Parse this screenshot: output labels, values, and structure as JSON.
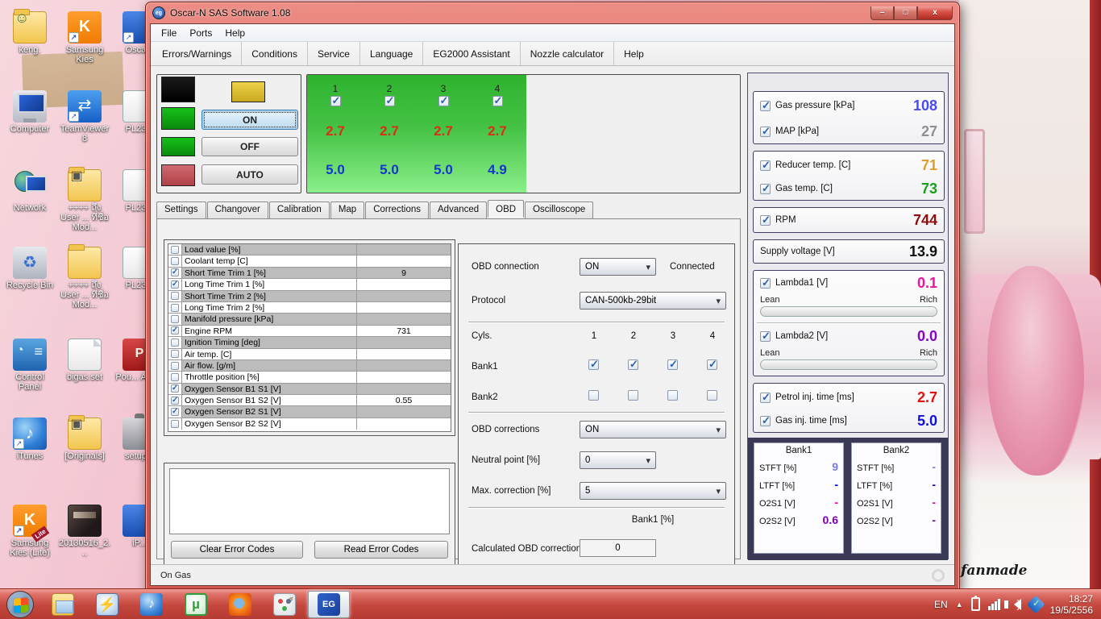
{
  "colors": {
    "window_glass": "#d9655c",
    "taskbar": "#c4473d",
    "panel_green_top": "#2eb32e",
    "panel_green_bottom": "#8aef8a",
    "banks_bg": "#3a3a56",
    "inj_red": "#d83010",
    "inj_blue": "#1238cc",
    "gas_pressure": "#4a4af2",
    "map": "#8f8f8f",
    "reducer_temp": "#e09c28",
    "gas_temp": "#18a018",
    "rpm": "#8c0d0d",
    "supply_voltage": "#111111",
    "lambda1": "#f012a0",
    "lambda2": "#8a00c8",
    "petrol_inj": "#e01010",
    "gas_inj": "#1010dc",
    "stft": "#7a7ae8",
    "ltft": "#0000cc",
    "o2s1": "#e600a6",
    "o2s2": "#7a00c0"
  },
  "window": {
    "title": "Oscar-N SAS Software 1.08",
    "title_icon": "eg",
    "buttons": {
      "minimize": "–",
      "maximize": "□",
      "close": "x"
    },
    "menu": {
      "file": "File",
      "ports": "Ports",
      "help": "Help"
    },
    "toolbar": {
      "items": [
        "Errors/Warnings",
        "Conditions",
        "Service",
        "Language",
        "EG2000 Assistant",
        "Nozzle calculator",
        "Help"
      ]
    },
    "controls": {
      "on": "ON",
      "off": "OFF",
      "auto": "AUTO"
    },
    "injectors": {
      "cols": [
        {
          "n": "1",
          "checked": true,
          "petrol": "2.7",
          "gas": "5.0"
        },
        {
          "n": "2",
          "checked": true,
          "petrol": "2.7",
          "gas": "5.0"
        },
        {
          "n": "3",
          "checked": true,
          "petrol": "2.7",
          "gas": "5.0"
        },
        {
          "n": "4",
          "checked": true,
          "petrol": "2.7",
          "gas": "4.9"
        }
      ]
    },
    "tabs": {
      "items": [
        "Settings",
        "Changover",
        "Calibration",
        "Map",
        "Corrections",
        "Advanced",
        "OBD",
        "Oscilloscope"
      ],
      "active": "OBD"
    },
    "obd_list": {
      "rows": [
        {
          "label": "Load value [%]",
          "checked": false,
          "value": ""
        },
        {
          "label": "Coolant temp [C]",
          "checked": false,
          "value": ""
        },
        {
          "label": "Short Time Trim 1 [%]",
          "checked": true,
          "value": "9"
        },
        {
          "label": "Long Time Trim 1 [%]",
          "checked": true,
          "value": ""
        },
        {
          "label": "Short Time Trim 2 [%]",
          "checked": false,
          "value": ""
        },
        {
          "label": "Long Time Trim 2 [%]",
          "checked": false,
          "value": ""
        },
        {
          "label": "Manifold pressure [kPa]",
          "checked": false,
          "value": ""
        },
        {
          "label": "Engine RPM",
          "checked": true,
          "value": "731"
        },
        {
          "label": "Ignition Timing [deg]",
          "checked": false,
          "value": ""
        },
        {
          "label": "Air temp. [C]",
          "checked": false,
          "value": ""
        },
        {
          "label": "Air flow. [g/m]",
          "checked": false,
          "value": ""
        },
        {
          "label": "Throttle position [%]",
          "checked": false,
          "value": ""
        },
        {
          "label": "Oxygen Sensor B1 S1 [V]",
          "checked": true,
          "value": ""
        },
        {
          "label": "Oxygen Sensor B1 S2 [V]",
          "checked": true,
          "value": "0.55"
        },
        {
          "label": "Oxygen Sensor B2 S1 [V]",
          "checked": true,
          "value": ""
        },
        {
          "label": "Oxygen Sensor B2 S2 [V]",
          "checked": false,
          "value": ""
        }
      ]
    },
    "error_codes": {
      "clear": "Clear Error Codes",
      "read": "Read Error Codes"
    },
    "obd_panel": {
      "connection_label": "OBD connection",
      "connection_value": "ON",
      "connection_status": "Connected",
      "protocol_label": "Protocol",
      "protocol_value": "CAN-500kb-29bit",
      "cyls_label": "Cyls.",
      "cyl_numbers": [
        "1",
        "2",
        "3",
        "4"
      ],
      "bank1_label": "Bank1",
      "bank1_checked": [
        true,
        true,
        true,
        true
      ],
      "bank2_label": "Bank2",
      "bank2_checked": [
        false,
        false,
        false,
        false
      ],
      "corrections_label": "OBD corrections",
      "corrections_value": "ON",
      "neutral_label": "Neutral point [%]",
      "neutral_value": "0",
      "max_corr_label": "Max. correction [%]",
      "max_corr_value": "5",
      "bank1_pct_label": "Bank1 [%]",
      "calc_label": "Calculated OBD corrections",
      "calc_value": "0"
    },
    "sensors": {
      "gas_pressure": {
        "label": "Gas pressure [kPa]",
        "value": "108",
        "checked": true
      },
      "map": {
        "label": "MAP [kPa]",
        "value": "27",
        "checked": true
      },
      "reducer_temp": {
        "label": "Reducer temp. [C]",
        "value": "71",
        "checked": true
      },
      "gas_temp": {
        "label": "Gas temp. [C]",
        "value": "73",
        "checked": true
      },
      "rpm": {
        "label": "RPM",
        "value": "744",
        "checked": true
      },
      "supply_voltage": {
        "label": "Supply voltage [V]",
        "value": "13.9"
      },
      "lambda1": {
        "label": "Lambda1 [V]",
        "value": "0.1",
        "lean": "Lean",
        "rich": "Rich",
        "checked": true
      },
      "lambda2": {
        "label": "Lambda2 [V]",
        "value": "0.0",
        "lean": "Lean",
        "rich": "Rich",
        "checked": true
      },
      "petrol_inj": {
        "label": "Petrol inj. time [ms]",
        "value": "2.7",
        "checked": true
      },
      "gas_inj": {
        "label": "Gas inj. time [ms]",
        "value": "5.0",
        "checked": true
      }
    },
    "banks": {
      "bank1": {
        "title": "Bank1",
        "rows": [
          {
            "label": "STFT [%]",
            "value": "9"
          },
          {
            "label": "LTFT [%]",
            "value": "-"
          },
          {
            "label": "O2S1 [V]",
            "value": "-"
          },
          {
            "label": "O2S2 [V]",
            "value": "0.6"
          }
        ]
      },
      "bank2": {
        "title": "Bank2",
        "rows": [
          {
            "label": "STFT [%]",
            "value": "-"
          },
          {
            "label": "LTFT [%]",
            "value": "-"
          },
          {
            "label": "O2S1 [V]",
            "value": "-"
          },
          {
            "label": "O2S2 [V]",
            "value": "-"
          }
        ]
      }
    },
    "status": "On Gas"
  },
  "desktop": {
    "fanmade_text": "fanmade",
    "icons": [
      {
        "label": "keng."
      },
      {
        "label": "Samsung Kies"
      },
      {
        "label": "Osca..."
      },
      {
        "label": "Computer"
      },
      {
        "label": "TeamViewer 8"
      },
      {
        "label": "PL23..."
      },
      {
        "label": "Network"
      },
      {
        "label": "++++ ถึง User ... ที่ชื่อ Mod..."
      },
      {
        "label": "PL23..."
      },
      {
        "label": "Recycle Bin"
      },
      {
        "label": "++++ ถึง User ... ที่ชื่อ Mod..."
      },
      {
        "label": "PL23..."
      },
      {
        "label": "Control Panel"
      },
      {
        "label": "bigas.set"
      },
      {
        "label": "Pou... Alar..."
      },
      {
        "label": "iTunes"
      },
      {
        "label": "[Originals]"
      },
      {
        "label": "setup..."
      },
      {
        "label": "Samsung Kies (Lite)"
      },
      {
        "label": "20130516_2..."
      },
      {
        "label": "iP..."
      }
    ]
  },
  "taskbar": {
    "language": "EN",
    "time": "18:27",
    "date": "19/5/2556",
    "utorrent_glyph": "µ",
    "daemon_glyph": "⚡",
    "itunes_glyph": "♪",
    "recycle_glyph": "♻",
    "eg_glyph": "EG"
  }
}
